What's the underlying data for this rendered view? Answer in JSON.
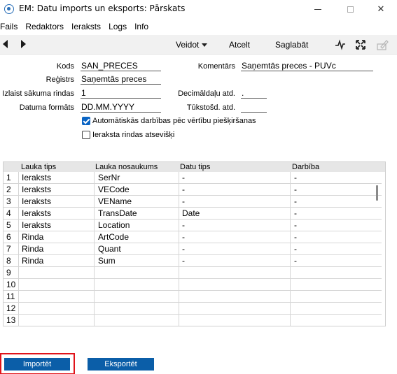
{
  "window": {
    "title": "EM: Datu imports un eksports: Pārskats"
  },
  "menu": [
    "Fails",
    "Redaktors",
    "Ieraksts",
    "Logs",
    "Info"
  ],
  "toolbar": {
    "create": "Veidot",
    "cancel": "Atcelt",
    "save": "Saglabāt"
  },
  "form": {
    "kods_label": "Kods",
    "kods_value": "SAN_PRECES",
    "registrs_label": "Reģistrs",
    "registrs_value": "Saņemtās preces",
    "skip_label": "Izlaist sākuma rindas",
    "skip_value": "1",
    "date_format_label": "Datuma formāts",
    "date_format_value": "DD.MM.YYYY",
    "comment_label": "Komentārs",
    "comment_value": "Saņemtās preces - PUVc",
    "decimal_label": "Decimāldaļu atd.",
    "decimal_value": ".",
    "thousand_label": "Tūkstošd. atd.",
    "thousand_value": "",
    "auto_actions_label": "Automātiskās darbības pēc vērtību piešķiršanas",
    "auto_actions_checked": true,
    "separate_rows_label": "Ieraksta rindas atsevišķi",
    "separate_rows_checked": false
  },
  "table": {
    "columns": [
      "Lauka tips",
      "Lauka nosaukums",
      "Datu tips",
      "Darbība"
    ],
    "rows": [
      {
        "n": "1",
        "type": "Ieraksts",
        "name": "SerNr",
        "dtype": "-",
        "action": "-"
      },
      {
        "n": "2",
        "type": "Ieraksts",
        "name": "VECode",
        "dtype": "-",
        "action": "-"
      },
      {
        "n": "3",
        "type": "Ieraksts",
        "name": "VEName",
        "dtype": "-",
        "action": "-"
      },
      {
        "n": "4",
        "type": "Ieraksts",
        "name": "TransDate",
        "dtype": "Date",
        "action": "-"
      },
      {
        "n": "5",
        "type": "Ieraksts",
        "name": "Location",
        "dtype": "-",
        "action": "-"
      },
      {
        "n": "6",
        "type": "Rinda",
        "name": "ArtCode",
        "dtype": "-",
        "action": "-"
      },
      {
        "n": "7",
        "type": "Rinda",
        "name": "Quant",
        "dtype": "-",
        "action": "-"
      },
      {
        "n": "8",
        "type": "Rinda",
        "name": "Sum",
        "dtype": "-",
        "action": "-"
      },
      {
        "n": "9",
        "type": "",
        "name": "",
        "dtype": "",
        "action": ""
      },
      {
        "n": "10",
        "type": "",
        "name": "",
        "dtype": "",
        "action": ""
      },
      {
        "n": "11",
        "type": "",
        "name": "",
        "dtype": "",
        "action": ""
      },
      {
        "n": "12",
        "type": "",
        "name": "",
        "dtype": "",
        "action": ""
      },
      {
        "n": "13",
        "type": "",
        "name": "",
        "dtype": "",
        "action": ""
      }
    ]
  },
  "buttons": {
    "import": "Importēt",
    "export": "Eksportēt"
  },
  "icons": {
    "app": "app-logo-icon",
    "wave": "activity-wave-icon",
    "expand": "expand-arrows-icon",
    "pencil": "edit-pencil-icon"
  },
  "colors": {
    "accent": "#0b5ea8",
    "highlight": "#e0131a",
    "checkbox": "#0a64c4"
  }
}
